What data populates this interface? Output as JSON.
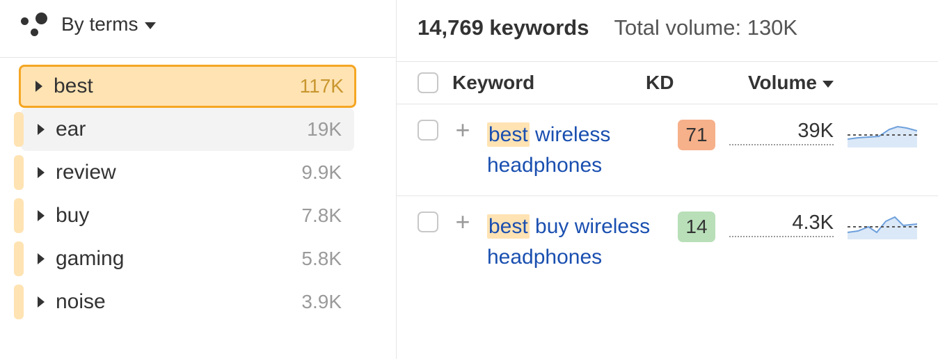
{
  "sidebar": {
    "grouping_label": "By terms",
    "terms": [
      {
        "label": "best",
        "count": "117K",
        "selected": true
      },
      {
        "label": "ear",
        "count": "19K",
        "hover": true
      },
      {
        "label": "review",
        "count": "9.9K"
      },
      {
        "label": "buy",
        "count": "7.8K"
      },
      {
        "label": "gaming",
        "count": "5.8K"
      },
      {
        "label": "noise",
        "count": "3.9K"
      }
    ]
  },
  "header": {
    "keyword_count": "14,769 keywords",
    "total_volume": "Total volume: 130K"
  },
  "table": {
    "columns": {
      "keyword": "Keyword",
      "kd": "KD",
      "volume": "Volume"
    },
    "rows": [
      {
        "highlight": "best",
        "rest": " wireless headphones",
        "kd": "71",
        "kd_class": "kd-orange",
        "volume": "39K"
      },
      {
        "highlight": "best",
        "rest": " buy wireless headphones",
        "kd": "14",
        "kd_class": "kd-green",
        "volume": "4.3K"
      }
    ]
  }
}
